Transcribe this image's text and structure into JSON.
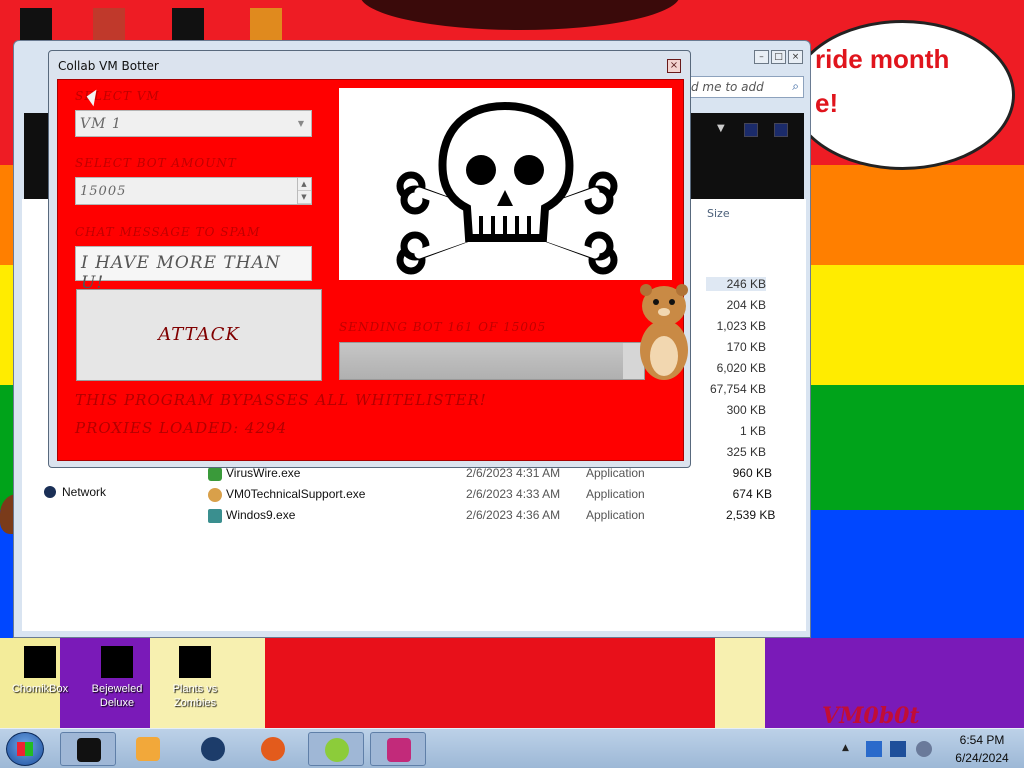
{
  "desktop": {
    "bubble_line1": "ride month",
    "bubble_line2": "e!",
    "watermark": "VM0b0t",
    "icons": [
      {
        "label": "ChomikBox",
        "icon": "chomikbox-icon"
      },
      {
        "label": "Bejeweled Deluxe",
        "icon": "bejeweled-icon"
      },
      {
        "label": "Plants vs Zombies",
        "icon": "plants-vs-zombies-icon"
      }
    ]
  },
  "explorer": {
    "search_placeholder": "d me to add",
    "column_size": "Size",
    "nav_network": "Network",
    "sizes": [
      "246 KB",
      "204 KB",
      "1,023 KB",
      "170 KB",
      "6,020 KB",
      "67,754 KB",
      "300 KB",
      "1 KB",
      "325 KB"
    ],
    "files": [
      {
        "name": "VirusWire.exe",
        "date": "2/6/2023 4:31 AM",
        "type": "Application",
        "size": "960 KB"
      },
      {
        "name": "VM0TechnicalSupport.exe",
        "date": "2/6/2023 4:33 AM",
        "type": "Application",
        "size": "674 KB"
      },
      {
        "name": "Windos9.exe",
        "date": "2/6/2023 4:36 AM",
        "type": "Application",
        "size": "2,539 KB"
      }
    ]
  },
  "botter": {
    "title": "Collab VM Botter",
    "close_glyph": "×",
    "select_vm_label": "SELECT VM",
    "select_vm_value": "VM 1",
    "bot_amount_label": "SELECT BOT AMOUNT",
    "bot_amount_value": "15005",
    "chat_label": "CHAT MESSAGE TO SPAM",
    "chat_value": "I HAVE MORE THAN U!",
    "attack_label": "ATTACK",
    "sending_text": "SENDING BOT 161 OF 15005",
    "progress_fraction": 0.93,
    "bypass_text": "THIS PROGRAM BYPASSES ALL WHITELISTER!",
    "proxies_text": "PROXIES LOADED: 4294",
    "accent_color": "#ff0000"
  },
  "taskbar": {
    "time": "6:54 PM",
    "date": "6/24/2024",
    "apps": [
      "terminal-icon",
      "media-player-icon",
      "globe-icon",
      "firefox-icon",
      "lime-icon",
      "gallery-icon"
    ]
  }
}
